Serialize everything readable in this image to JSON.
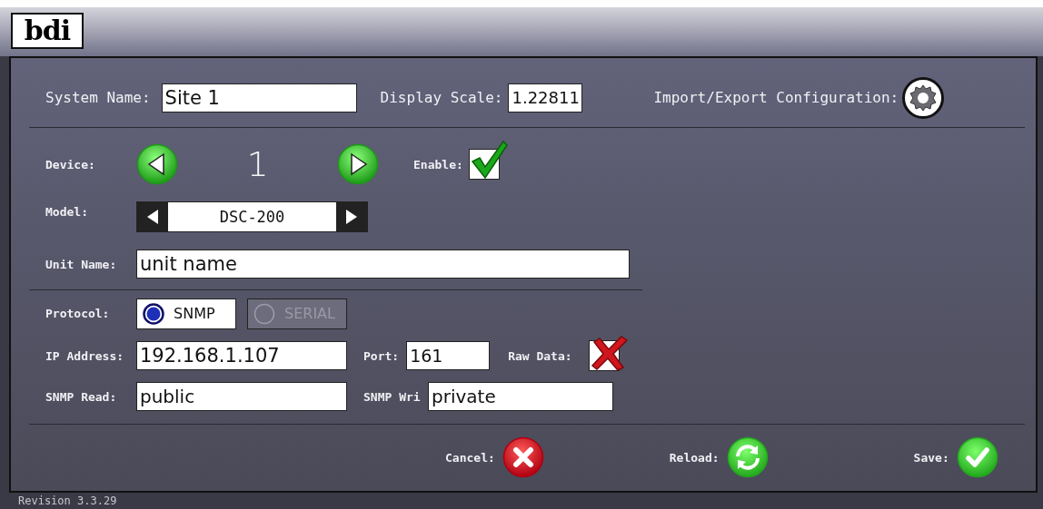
{
  "header": {
    "logo": "bdi"
  },
  "system": {
    "name_label": "System Name:",
    "name_value": "Site 1",
    "scale_label": "Display Scale:",
    "scale_value": "1.22811",
    "config_label": "Import/Export Configuration:"
  },
  "device": {
    "label": "Device:",
    "number": "1",
    "enable_label": "Enable:",
    "enabled": true
  },
  "model": {
    "label": "Model:",
    "value": "DSC-200"
  },
  "unit": {
    "label": "Unit Name:",
    "value": "unit name"
  },
  "protocol": {
    "label": "Protocol:",
    "options": [
      {
        "label": "SNMP",
        "selected": true,
        "disabled": false
      },
      {
        "label": "SERIAL",
        "selected": false,
        "disabled": true
      }
    ]
  },
  "ip": {
    "label": "IP Address:",
    "value": "192.168.1.107"
  },
  "port": {
    "label": "Port:",
    "value": "161"
  },
  "raw_data": {
    "label": "Raw Data:",
    "checked": false
  },
  "snmp_read": {
    "label": "SNMP Read:",
    "value": "public"
  },
  "snmp_write": {
    "label": "SNMP Wri",
    "value": "private"
  },
  "actions": [
    {
      "kind": "cancel",
      "label": "Cancel:"
    },
    {
      "kind": "reload",
      "label": "Reload:"
    },
    {
      "kind": "save",
      "label": "Save:"
    }
  ],
  "revision": "Revision 3.3.29"
}
